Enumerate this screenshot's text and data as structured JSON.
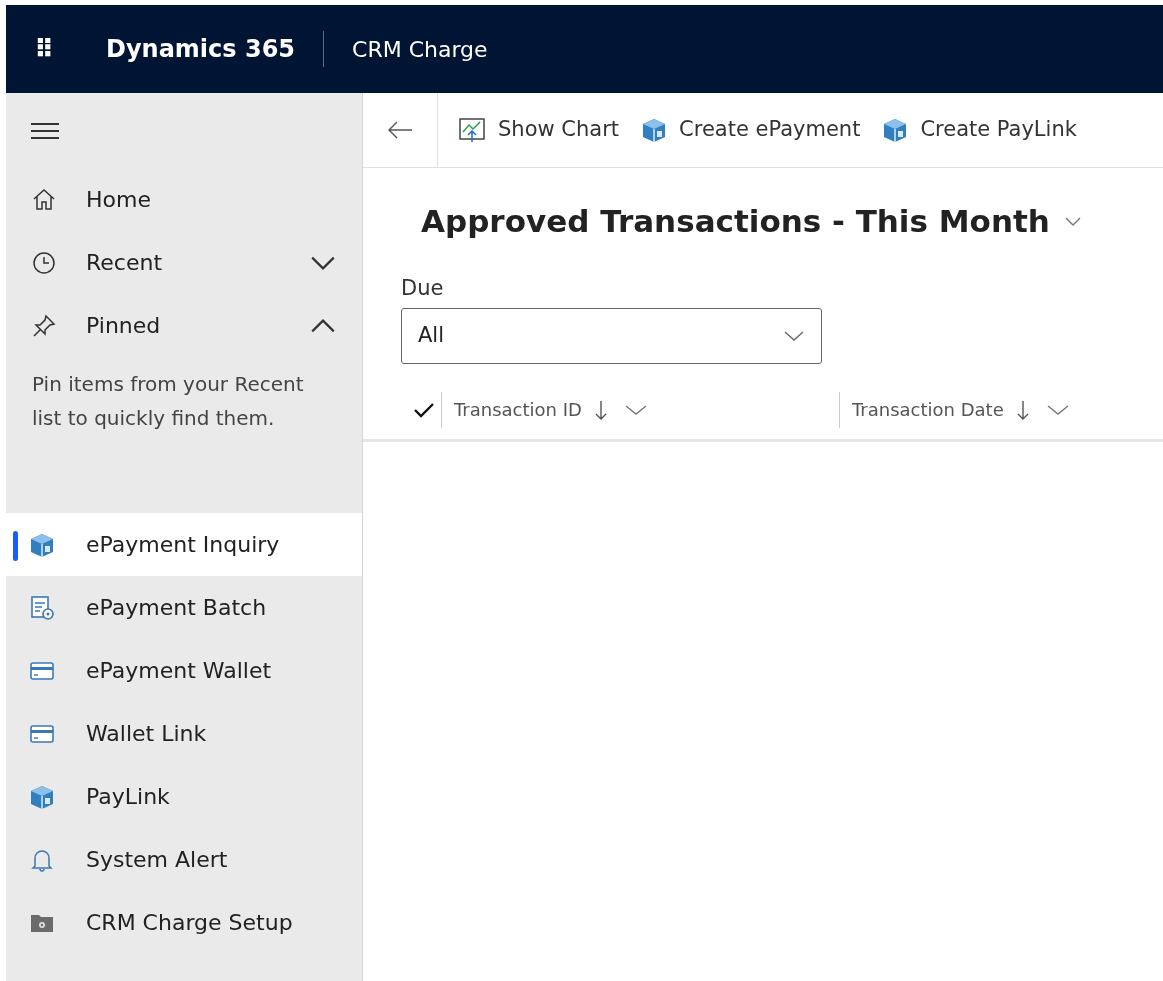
{
  "header": {
    "app_launcher": "⠿",
    "product": "Dynamics 365",
    "app_name": "CRM Charge"
  },
  "sidebar": {
    "nav": [
      {
        "label": "Home",
        "kind": "link"
      },
      {
        "label": "Recent",
        "kind": "group",
        "expanded": false
      },
      {
        "label": "Pinned",
        "kind": "group",
        "expanded": true
      }
    ],
    "pinned_hint": "Pin items from your Recent list to quickly find them.",
    "items": [
      {
        "label": "ePayment Inquiry",
        "selected": true
      },
      {
        "label": "ePayment Batch",
        "selected": false
      },
      {
        "label": "ePayment Wallet",
        "selected": false
      },
      {
        "label": "Wallet Link",
        "selected": false
      },
      {
        "label": "PayLink",
        "selected": false
      },
      {
        "label": "System Alert",
        "selected": false
      },
      {
        "label": "CRM Charge Setup",
        "selected": false
      }
    ]
  },
  "command_bar": [
    "Show Chart",
    "Create ePayment",
    "Create PayLink"
  ],
  "view_title": "Approved Transactions - This Month",
  "filter": {
    "label": "Due",
    "value": "All"
  },
  "table": {
    "columns": [
      "Transaction ID",
      "Transaction Date"
    ]
  }
}
